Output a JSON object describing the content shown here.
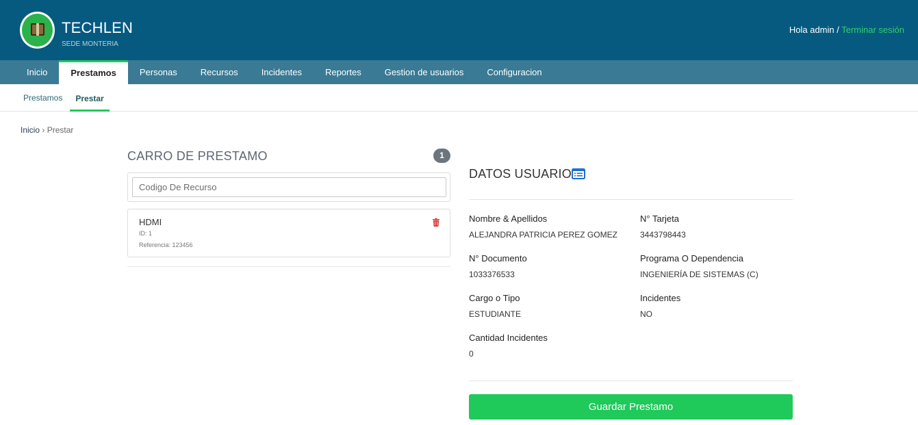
{
  "header": {
    "title": "TECHLEN",
    "subtitle": "SEDE MONTERIA",
    "greeting": "Hola admin /",
    "logout": "Terminar sesión"
  },
  "main_nav": {
    "tabs": [
      {
        "label": "Inicio"
      },
      {
        "label": "Prestamos",
        "active": true
      },
      {
        "label": "Personas"
      },
      {
        "label": "Recursos"
      },
      {
        "label": "Incidentes"
      },
      {
        "label": "Reportes"
      },
      {
        "label": "Gestion de usuarios"
      },
      {
        "label": "Configuracion"
      }
    ]
  },
  "sub_nav": {
    "tabs": [
      {
        "label": "Prestamos"
      },
      {
        "label": "Prestar",
        "active": true
      }
    ]
  },
  "breadcrumb": {
    "home": "Inicio",
    "separator": "›",
    "current": "Prestar"
  },
  "cart": {
    "title": "CARRO DE PRESTAMO",
    "count": "1",
    "search_placeholder": "Codigo De Recurso",
    "items": [
      {
        "name": "HDMI",
        "id": "ID: 1",
        "reference": "Referencia: 123456"
      }
    ]
  },
  "user": {
    "title": "DATOS USUARIO",
    "fields": [
      {
        "label": "Nombre & Apellidos",
        "value": "ALEJANDRA PATRICIA PEREZ GOMEZ"
      },
      {
        "label": "N° Tarjeta",
        "value": "3443798443"
      },
      {
        "label": "N° Documento",
        "value": "1033376533"
      },
      {
        "label": "Programa O Dependencia",
        "value": "INGENIERÍA DE SISTEMAS (C)"
      },
      {
        "label": "Cargo o Tipo",
        "value": "ESTUDIANTE"
      },
      {
        "label": "Incidentes",
        "value": "NO"
      },
      {
        "label": "Cantidad Incidentes",
        "value": "0"
      }
    ]
  },
  "actions": {
    "save_label": "Guardar Prestamo"
  },
  "colors": {
    "header_bg": "#065a80",
    "nav_bg": "#3a7a95",
    "accent_green": "#1fc95a",
    "badge_gray": "#6c757d",
    "delete_red": "#d9262b"
  },
  "icons": {
    "logo": "box-logo-icon",
    "delete": "trash-icon",
    "user_card": "id-card-icon"
  }
}
